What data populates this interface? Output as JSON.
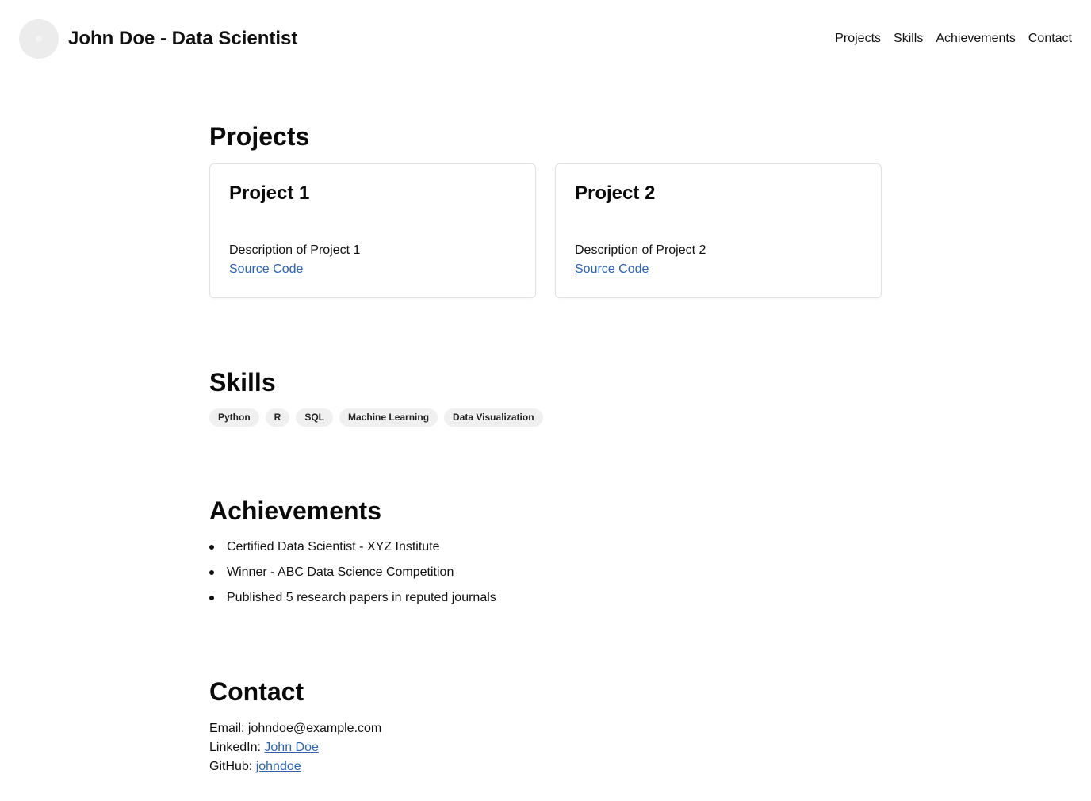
{
  "header": {
    "title": "John Doe - Data Scientist",
    "nav": [
      "Projects",
      "Skills",
      "Achievements",
      "Contact"
    ]
  },
  "projects": {
    "title": "Projects",
    "items": [
      {
        "name": "Project 1",
        "description": "Description of Project 1",
        "link_label": "Source Code"
      },
      {
        "name": "Project 2",
        "description": "Description of Project 2",
        "link_label": "Source Code"
      }
    ]
  },
  "skills": {
    "title": "Skills",
    "items": [
      "Python",
      "R",
      "SQL",
      "Machine Learning",
      "Data Visualization"
    ]
  },
  "achievements": {
    "title": "Achievements",
    "items": [
      "Certified Data Scientist - XYZ Institute",
      "Winner - ABC Data Science Competition",
      "Published 5 research papers in reputed journals"
    ]
  },
  "contact": {
    "title": "Contact",
    "email_label": "Email:",
    "email_value": "johndoe@example.com",
    "linkedin_label": "LinkedIn:",
    "linkedin_link": "John Doe",
    "github_label": "GitHub:",
    "github_link": "johndoe"
  },
  "colors": {
    "link": "#2b63b8",
    "tag_bg": "#f0f0f0",
    "card_border": "#e2e2e2",
    "avatar_bg": "#ececec"
  }
}
